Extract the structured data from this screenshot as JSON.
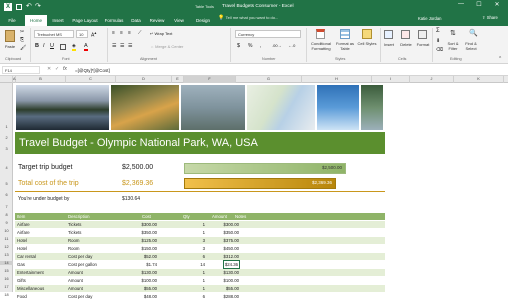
{
  "window": {
    "title": "Travel Budgets Consumer - Excel",
    "context_label": "Table Tools",
    "search_placeholder": "Tell me what you want to do...",
    "user": "Katie Jordan",
    "share": "Share"
  },
  "tabs": [
    "File",
    "Home",
    "Insert",
    "Page Layout",
    "Formulas",
    "Data",
    "Review",
    "View",
    "Design"
  ],
  "ribbon": {
    "paste": "Paste",
    "clipboard": "Clipboard",
    "font_name": "Trebuchet MS",
    "font_size": "10",
    "font": "Font",
    "wrap": "Wrap Text",
    "merge": "Merge & Center",
    "alignment": "Alignment",
    "number_format": "Currency",
    "number": "Number",
    "cond": "Conditional Formatting",
    "fmt_table": "Format as Table",
    "cell_styles": "Cell Styles",
    "styles": "Styles",
    "insert": "Insert",
    "delete": "Delete",
    "format": "Format",
    "cells": "Cells",
    "sort": "Sort & Filter",
    "find": "Find & Select",
    "editing": "Editing"
  },
  "formula_bar": {
    "name_box": "F14",
    "formula": "=[@Qty]*[@Cost]"
  },
  "columns": [
    "A",
    "B",
    "C",
    "D",
    "E",
    "F",
    "G",
    "H",
    "I",
    "J",
    "K"
  ],
  "rows": [
    "1",
    "2",
    "3",
    "4",
    "5",
    "6",
    "7",
    "8",
    "9",
    "10",
    "11",
    "12",
    "13",
    "14",
    "15",
    "16",
    "17",
    "18"
  ],
  "sheet": {
    "banner_title": "Travel Budget - Olympic National Park, WA, USA",
    "target_label": "Target trip budget",
    "target_value": "$2,500.00",
    "target_bar": "$2,500.00",
    "target_fill": 1.0,
    "total_label": "Total cost of the trip",
    "total_value": "$2,369.36",
    "total_bar": "$2,369.36",
    "total_fill": 0.948,
    "under_label": "You're under budget by",
    "under_value": "$130.64",
    "headers": [
      "Item",
      "Description",
      "Cost",
      "Qty",
      "Amount",
      "Notes"
    ],
    "items": [
      [
        "Airfare",
        "Tickets",
        "$300.00",
        "1",
        "$300.00"
      ],
      [
        "Airfare",
        "Tickets",
        "$350.00",
        "1",
        "$350.00"
      ],
      [
        "Hotel",
        "Room",
        "$125.00",
        "3",
        "$375.00"
      ],
      [
        "Hotel",
        "Room",
        "$150.00",
        "3",
        "$450.00"
      ],
      [
        "Car rental",
        "Cost per day",
        "$52.00",
        "6",
        "$312.00"
      ],
      [
        "Gas",
        "Cost per gallon",
        "$1.74",
        "14",
        "$24.36"
      ],
      [
        "Entertainment",
        "Amount",
        "$130.00",
        "1",
        "$130.00"
      ],
      [
        "Gifts",
        "Amount",
        "$100.00",
        "1",
        "$100.00"
      ],
      [
        "Miscellaneous",
        "Amount",
        "$55.00",
        "1",
        "$55.00"
      ],
      [
        "Food",
        "Cost per day",
        "$48.00",
        "6",
        "$288.00"
      ]
    ]
  },
  "colors": {
    "excel_green": "#217346",
    "banner": "#5b8f2e",
    "gold": "#c9971c",
    "light_green": "#c6d8a8"
  }
}
